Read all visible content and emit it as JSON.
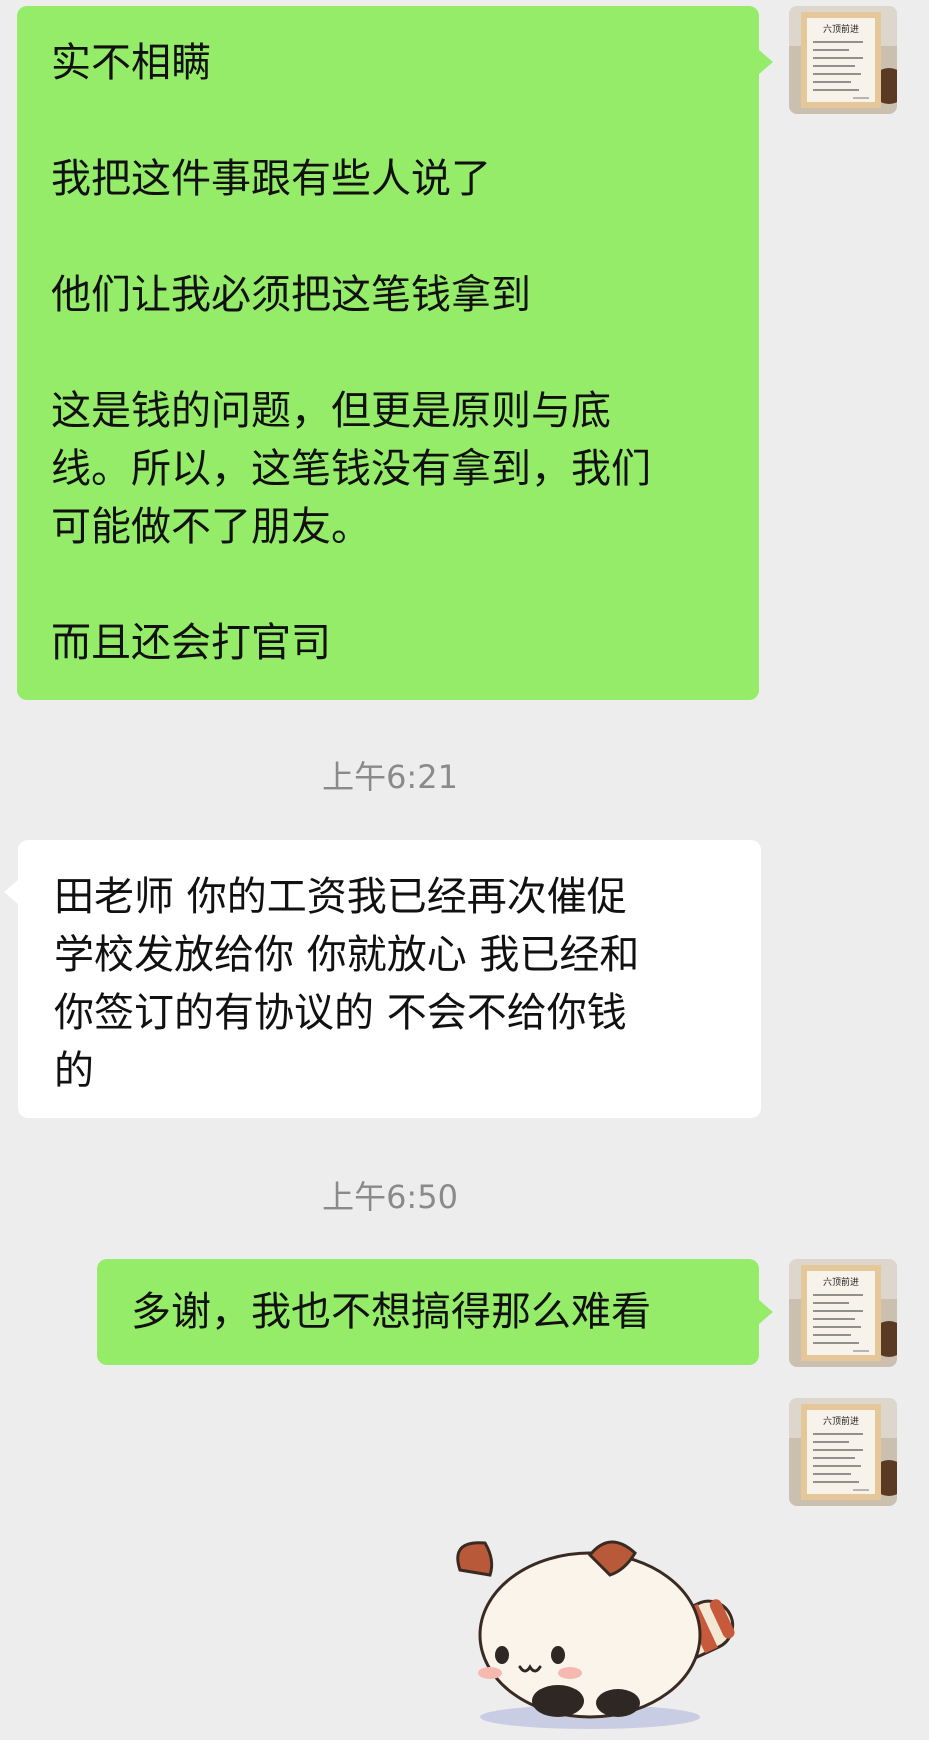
{
  "messages": [
    {
      "side": "mine",
      "lines": [
        "实不相瞒",
        "",
        "我把这件事跟有些人说了",
        "",
        "他们让我必须把这笔钱拿到",
        "",
        "这是钱的问题，但更是原则与底",
        "线。所以，这笔钱没有拿到，我们",
        "可能做不了朋友。",
        "",
        "而且还会打官司"
      ]
    },
    {
      "side": "theirs",
      "lines": [
        "田老师  你的工资我已经再次催促",
        "学校发放给你  你就放心  我已经和",
        "你签订的有协议的  不会不给你钱",
        "的"
      ]
    },
    {
      "side": "mine",
      "lines": [
        "多谢，我也不想搞得那么难看"
      ]
    }
  ],
  "timestamps": [
    "上午6:21",
    "上午6:50"
  ],
  "avatar": {
    "title": "六顶前进",
    "icon": "framed-poster-avatar"
  },
  "sticker": {
    "icon": "red-panda-sticker"
  },
  "colors": {
    "background": "#ededed",
    "mine_bubble": "#95ec69",
    "their_bubble": "#ffffff",
    "timestamp": "#8a8a8a"
  }
}
